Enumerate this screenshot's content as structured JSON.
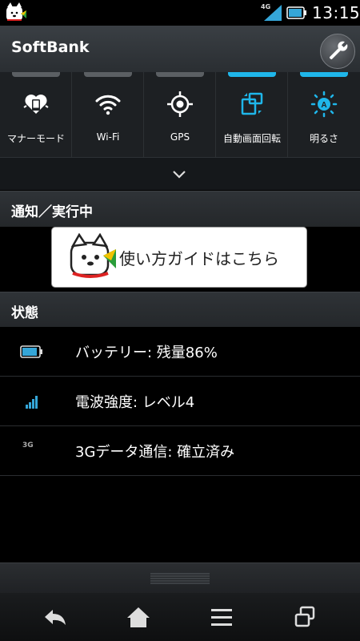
{
  "status_bar": {
    "network_type": "4G",
    "time": "13:15",
    "icons": [
      "softbank-dog-icon",
      "signal-strength-icon",
      "battery-icon"
    ]
  },
  "header": {
    "carrier": "SoftBank",
    "settings_icon": "wrench-icon"
  },
  "quick_toggles": [
    {
      "label": "マナーモード",
      "icon": "manner-mode-icon",
      "active": false
    },
    {
      "label": "Wi-Fi",
      "icon": "wifi-icon",
      "active": false
    },
    {
      "label": "GPS",
      "icon": "gps-icon",
      "active": false
    },
    {
      "label": "自動画面回転",
      "icon": "auto-rotate-icon",
      "active": true
    },
    {
      "label": "明るさ",
      "icon": "brightness-icon",
      "active": true
    }
  ],
  "expand_icon": "chevron-down-icon",
  "notifications": {
    "header": "通知／実行中",
    "guide_banner": "使い方ガイドはこちら"
  },
  "status_section": {
    "header": "状態",
    "rows": [
      {
        "icon": "battery-icon",
        "text": "バッテリー: 残量86%"
      },
      {
        "icon": "signal-icon",
        "text": "電波強度: レベル4"
      },
      {
        "icon": "3g-icon",
        "icon_text": "3G",
        "text": "3Gデータ通信: 確立済み"
      }
    ]
  },
  "nav_bar": {
    "buttons": [
      "back-icon",
      "home-icon",
      "menu-icon",
      "recent-apps-icon"
    ]
  },
  "colors": {
    "accent": "#1fb6ea",
    "inactive_indicator": "#5b5f63",
    "background": "#000000"
  }
}
